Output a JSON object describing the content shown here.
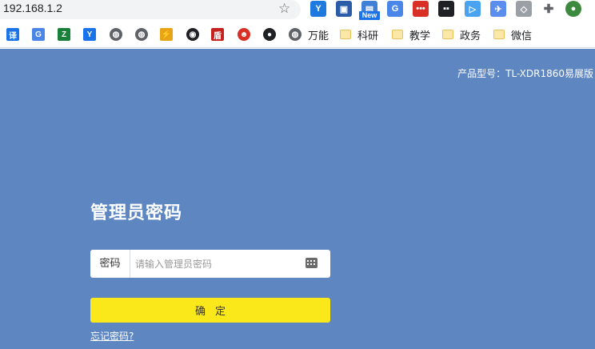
{
  "browser": {
    "url": "192.168.1.2",
    "extensions": [
      {
        "name": "extension-1",
        "color": "#1f7ae0",
        "glyph": "Y"
      },
      {
        "name": "extension-save",
        "color": "#2a5ca8",
        "glyph": "▣"
      },
      {
        "name": "extension-new",
        "color": "#3f7fd6",
        "glyph": "▤",
        "badge": "New"
      },
      {
        "name": "extension-translate",
        "color": "#4a86e8",
        "glyph": "G"
      },
      {
        "name": "extension-dots",
        "color": "#d93025",
        "glyph": "•••"
      },
      {
        "name": "extension-panel",
        "color": "#202124",
        "glyph": "▪▪"
      },
      {
        "name": "extension-play",
        "color": "#4aa3f0",
        "glyph": "▷"
      },
      {
        "name": "extension-bird",
        "color": "#5b8def",
        "glyph": "✈"
      },
      {
        "name": "extension-shield",
        "color": "#9aa0a6",
        "glyph": "◇"
      },
      {
        "name": "extensions-puzzle",
        "color": "#5f6368",
        "glyph": "✚"
      },
      {
        "name": "profile-avatar",
        "color": "#3b8a3e",
        "glyph": "●"
      }
    ],
    "bookmarks": [
      {
        "icon": "translate-icon",
        "color": "#1a73e8",
        "glyph": "译",
        "label": ""
      },
      {
        "icon": "google-translate-icon",
        "color": "#4a86e8",
        "glyph": "G",
        "label": ""
      },
      {
        "icon": "z-icon",
        "color": "#188038",
        "glyph": "Z",
        "label": ""
      },
      {
        "icon": "y-icon",
        "color": "#1a73e8",
        "glyph": "Y",
        "label": ""
      },
      {
        "icon": "globe-icon",
        "color": "#5f6368",
        "glyph": "◍",
        "label": ""
      },
      {
        "icon": "globe-icon",
        "color": "#5f6368",
        "glyph": "◍",
        "label": ""
      },
      {
        "icon": "bolt-icon",
        "color": "#e8a317",
        "glyph": "⚡",
        "label": ""
      },
      {
        "icon": "eye-icon",
        "color": "#202124",
        "glyph": "◉",
        "label": ""
      },
      {
        "icon": "seal-icon",
        "color": "#c5221f",
        "glyph": "盾",
        "label": ""
      },
      {
        "icon": "face-icon",
        "color": "#d93025",
        "glyph": "☻",
        "label": ""
      },
      {
        "icon": "github-icon",
        "color": "#202124",
        "glyph": "●",
        "label": ""
      },
      {
        "icon": "globe-icon",
        "color": "#5f6368",
        "glyph": "◍",
        "label": "万能"
      },
      {
        "icon": "folder-icon",
        "color": "#fce8a6",
        "glyph": "",
        "label": "科研"
      },
      {
        "icon": "folder-icon",
        "color": "#fce8a6",
        "glyph": "",
        "label": "教学"
      },
      {
        "icon": "folder-icon",
        "color": "#fce8a6",
        "glyph": "",
        "label": "政务"
      },
      {
        "icon": "folder-icon",
        "color": "#fce8a6",
        "glyph": "",
        "label": "微信"
      }
    ]
  },
  "page": {
    "background": "#5e86c1",
    "model_label": "产品型号：TL-XDR1860易展版",
    "title": "管理员密码",
    "password_label": "密码",
    "password_placeholder": "请输入管理员密码",
    "password_value": "",
    "confirm_label": "确定",
    "confirm_color": "#fbe81a",
    "forgot_link": "忘记密码?"
  }
}
